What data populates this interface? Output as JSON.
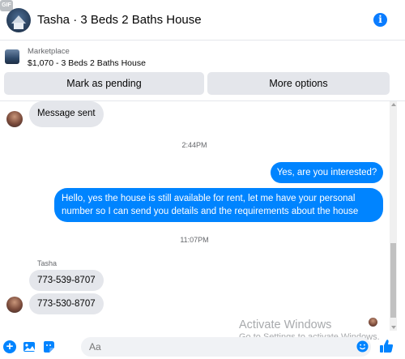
{
  "header": {
    "title": "Tasha · 3 Beds 2 Baths House",
    "info_glyph": "i"
  },
  "marketplace": {
    "label": "Marketplace",
    "item": "$1,070 - 3 Beds 2 Baths House",
    "pending_button": "Mark as pending",
    "more_button": "More options"
  },
  "messages": [
    {
      "direction": "in",
      "text": "Message sent"
    },
    {
      "timestamp": "2:44PM"
    },
    {
      "direction": "out",
      "text": "Yes, are you interested?"
    },
    {
      "direction": "out",
      "lines": [
        "Hello, yes the house is still available for rent, let me have your personal",
        "number so I can send you details and the requirements about the house"
      ]
    },
    {
      "timestamp": "11:07PM"
    },
    {
      "sender": "Tasha"
    },
    {
      "direction": "in",
      "text": "773-539-8707"
    },
    {
      "direction": "in",
      "text": "773-530-8707"
    }
  ],
  "watermark": {
    "title": "Activate Windows",
    "subtitle": "Go to Settings to activate Windows."
  },
  "composer": {
    "placeholder": "Aa",
    "gif_label": "GIF",
    "plus_glyph": "+"
  },
  "colors": {
    "accent": "#0084ff",
    "bubble_in": "#e4e6eb",
    "button_bg": "#e4e6eb",
    "info": "#0a7cff"
  },
  "icons": [
    "info-icon",
    "plus-icon",
    "image-icon",
    "sticker-icon",
    "gif-icon",
    "emoji-icon",
    "like-icon"
  ]
}
